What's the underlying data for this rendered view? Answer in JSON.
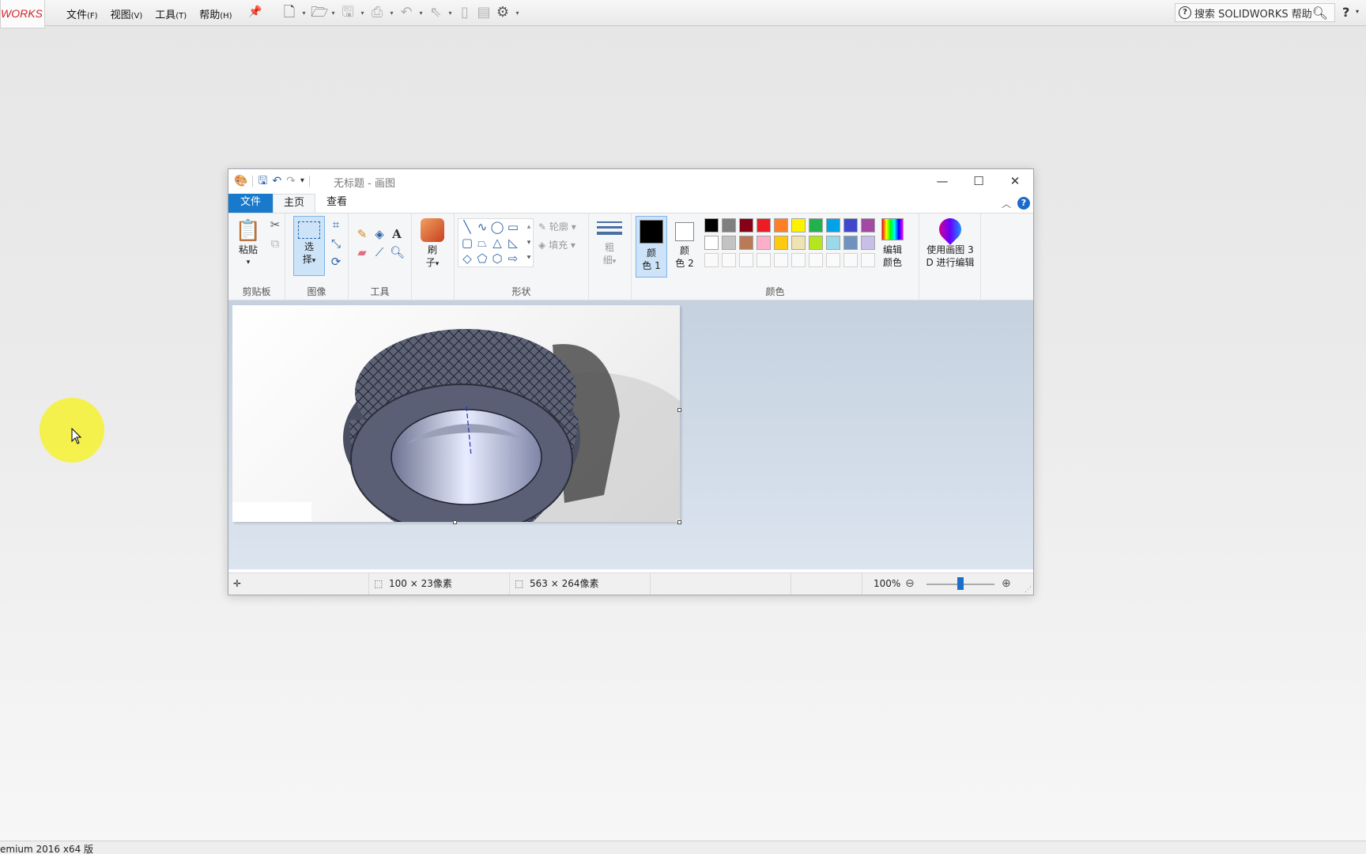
{
  "solidworks": {
    "logo": "WORKS",
    "menu": [
      {
        "label": "文件",
        "key": "(F)"
      },
      {
        "label": "视图",
        "key": "(V)"
      },
      {
        "label": "工具",
        "key": "(T)"
      },
      {
        "label": "帮助",
        "key": "(H)"
      }
    ],
    "search_placeholder": "搜索 SOLIDWORKS 帮助",
    "help_symbol": "?",
    "status_text": "emium 2016 x64 版"
  },
  "paint": {
    "title": "无标题 - 画图",
    "tabs": {
      "file": "文件",
      "home": "主页",
      "view": "查看"
    },
    "clipboard": {
      "paste": "粘贴",
      "group": "剪贴板"
    },
    "image": {
      "select_1": "选",
      "select_2": "择",
      "group": "图像"
    },
    "tools": {
      "group": "工具"
    },
    "brushes": {
      "label_1": "刷",
      "label_2": "子"
    },
    "shapes": {
      "outline": "轮廓",
      "fill": "填充",
      "group": "形状"
    },
    "size": {
      "label_1": "粗",
      "label_2": "细"
    },
    "colors": {
      "color1_a": "颜",
      "color1_b": "色 1",
      "color2_a": "颜",
      "color2_b": "色 2",
      "edit_a": "编辑",
      "edit_b": "颜色",
      "group": "颜色",
      "color1_value": "#000000",
      "color2_value": "#ffffff",
      "palette_row1": [
        "#000000",
        "#7f7f7f",
        "#880015",
        "#ed1c24",
        "#ff7f27",
        "#fff200",
        "#22b14c",
        "#00a2e8",
        "#3f48cc",
        "#a349a4"
      ],
      "palette_row2": [
        "#ffffff",
        "#c3c3c3",
        "#b97a57",
        "#ffaec9",
        "#ffc90e",
        "#efe4b0",
        "#b5e61d",
        "#99d9ea",
        "#7092be",
        "#c8bfe7"
      ]
    },
    "paint3d": {
      "line1": "使用画图 3",
      "line2": "D 进行编辑"
    },
    "status": {
      "selection_size": "100 × 23像素",
      "image_size": "563 × 264像素",
      "zoom": "100%"
    },
    "zoom_level": 0.5
  }
}
